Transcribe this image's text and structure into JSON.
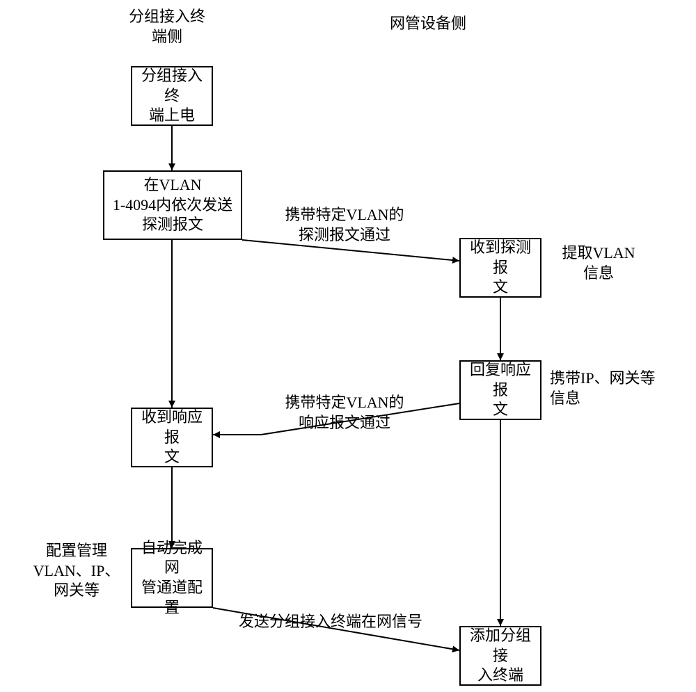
{
  "headers": {
    "left": "分组接入终\n端侧",
    "right": "网管设备侧"
  },
  "boxes": {
    "power_on": "分组接入终\n端上电",
    "send_probe": "在VLAN\n1-4094内依次发送\n探测报文",
    "recv_probe": "收到探测报\n文",
    "reply_resp": "回复响应报\n文",
    "recv_resp": "收到响应报\n文",
    "auto_config": "自动完成网\n管通道配置",
    "add_terminal": "添加分组接\n入终端"
  },
  "edges": {
    "probe_pass": "携带特定VLAN的\n探测报文通过",
    "extract_vlan": "提取VLAN\n信息",
    "carry_ip": "携带IP、网关等\n信息",
    "resp_pass": "携带特定VLAN的\n响应报文通过",
    "config_note": "配置管理\nVLAN、IP、\n网关等",
    "send_online": "发送分组接入终端在网信号"
  }
}
